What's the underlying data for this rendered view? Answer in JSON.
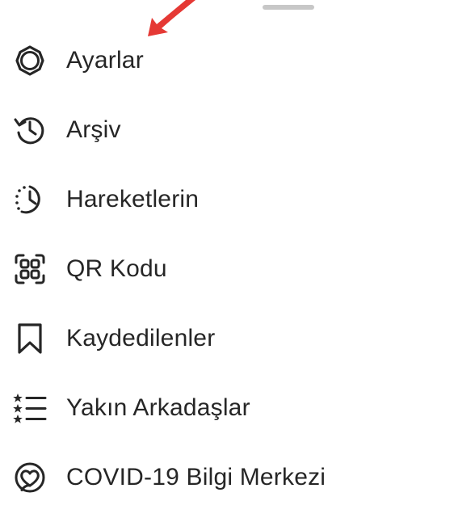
{
  "colors": {
    "text": "#262626",
    "icon": "#262626",
    "handle": "#c7c7c7",
    "annotation_arrow": "#e53935"
  },
  "menu": {
    "items": [
      {
        "label": "Ayarlar",
        "icon": "gear-icon"
      },
      {
        "label": "Arşiv",
        "icon": "archive-history-icon"
      },
      {
        "label": "Hareketlerin",
        "icon": "activity-clock-icon"
      },
      {
        "label": "QR Kodu",
        "icon": "qr-code-icon"
      },
      {
        "label": "Kaydedilenler",
        "icon": "bookmark-icon"
      },
      {
        "label": "Yakın Arkadaşlar",
        "icon": "close-friends-list-icon"
      },
      {
        "label": "COVID-19 Bilgi Merkezi",
        "icon": "covid-heart-icon"
      }
    ]
  }
}
